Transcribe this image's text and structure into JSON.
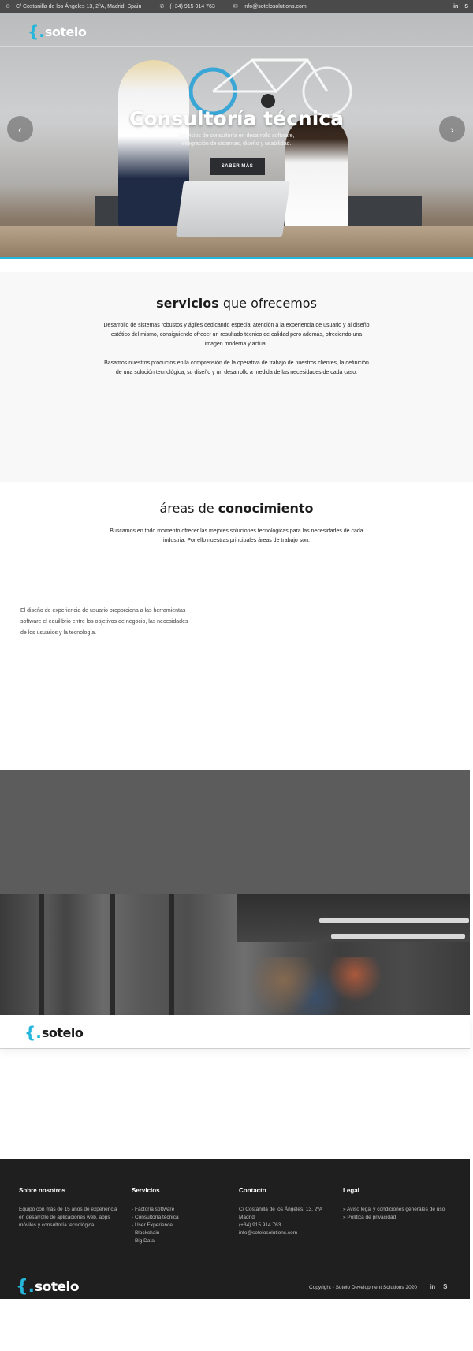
{
  "topbar": {
    "address": "C/ Costanilla de los Ángeles 13, 2ºA, Madrid, Spain",
    "phone": "(+34) 915 914 763",
    "email": "info@sotelosolutions.com",
    "social": [
      "in",
      "S"
    ],
    "icons": [
      "map-pin-icon",
      "phone-icon",
      "mail-icon"
    ]
  },
  "brand": {
    "brace": "{.",
    "name": "sotelo",
    "accent_color": "#25b6dc"
  },
  "hero": {
    "title": "Consultoría técnica",
    "subtitle": "Servicios de consultoría en desarrollo software, integración de sistemas, diseño y usabilidad.",
    "button": "SABER MÁS",
    "prev": "‹",
    "next": "›"
  },
  "services": {
    "title_bold": "servicios",
    "title_rest": " que ofrecemos",
    "p1": "Desarrollo de sistemas robustos y ágiles dedicando especial atención a la experiencia de usuario y al diseño estético del mismo, consiguiendo ofrecer un resultado técnico de calidad pero además,  ofreciendo una imagen moderna y actual.",
    "p2": "Basamos nuestros productos en la comprensión de la operativa de trabajo de nuestros clientes, la definición de una solución tecnológica, su diseño y un desarrollo a medida de las necesidades de cada caso."
  },
  "areas": {
    "title_rest": "áreas de ",
    "title_bold": "conocimiento",
    "intro": "Buscamos en todo momento ofrecer las mejores soluciones tecnológicas para las necesidades de cada industria. Por ello nuestras principales áreas de trabajo son:",
    "ux_text": "El diseño de experiencia de usuario proporciona a las herramientas software el equilibrio entre los objetivos de negocio, las necesidades de los usuarios y la tecnología."
  },
  "footer": {
    "about": {
      "heading": "Sobre nosotros",
      "text": "Equipo con más de 15 años de experiencia en desarrollo de aplicaciones web, apps móviles y consultoría tecnológica"
    },
    "services": {
      "heading": "Servicios",
      "items": [
        "- Factoría software",
        "- Consultoría técnica",
        "- User Experience",
        "- Blockchain",
        "- Big Data"
      ]
    },
    "contact": {
      "heading": "Contacto",
      "lines": [
        "C/ Costanilla de los Ángeles, 13, 2ºA",
        "Madrid",
        "(+34) 915 914 763",
        "info@sotelosolutions.com"
      ]
    },
    "legal": {
      "heading": "Legal",
      "items": [
        "» Aviso legal y condiciones generales de uso",
        "» Política de privacidad"
      ]
    },
    "copyright": "Copyright - Sotelo Development Solutions 2020",
    "social": [
      "in",
      "S"
    ]
  }
}
